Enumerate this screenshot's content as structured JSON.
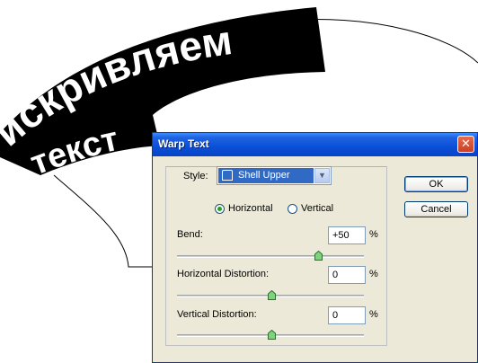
{
  "canvas": {
    "warped_line1": "искривляем",
    "warped_line2": "текст"
  },
  "dialog": {
    "title": "Warp Text",
    "close_label": "✕",
    "style": {
      "label": "Style:",
      "value": "Shell Upper"
    },
    "orientation": {
      "horizontal_label": "Horizontal",
      "vertical_label": "Vertical",
      "selected": "Horizontal"
    },
    "bend": {
      "label": "Bend:",
      "value": "+50",
      "unit": "%",
      "slider_value": 50
    },
    "horizontal_distortion": {
      "label": "Horizontal Distortion:",
      "value": "0",
      "unit": "%",
      "slider_value": 0
    },
    "vertical_distortion": {
      "label": "Vertical Distortion:",
      "value": "0",
      "unit": "%",
      "slider_value": 0
    },
    "ok_label": "OK",
    "cancel_label": "Cancel"
  }
}
